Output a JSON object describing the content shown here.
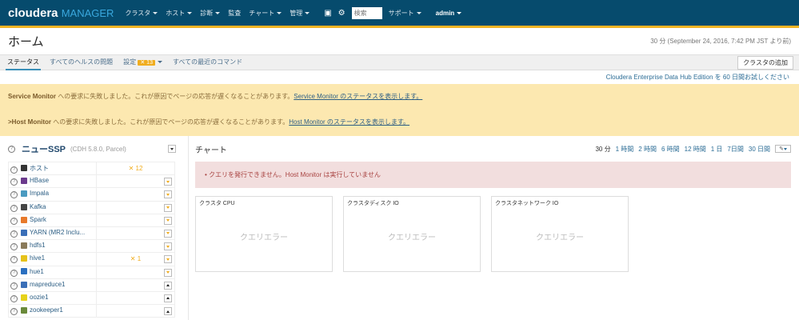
{
  "nav": {
    "logo_a": "cloudera",
    "logo_b": "MANAGER",
    "items": [
      "クラスタ",
      "ホスト",
      "診断",
      "監査",
      "チャート",
      "管理"
    ],
    "search_placeholder": "検索",
    "support": "サポート",
    "user": "admin"
  },
  "header": {
    "title": "ホーム",
    "timestamp": "30 分 (September 24, 2016, 7:42 PM JST より前)"
  },
  "tabs": {
    "status": "ステータス",
    "health": "すべてのヘルスの問題",
    "config": "設定",
    "config_badge": "13",
    "commands": "すべての最近のコマンド",
    "add_cluster": "クラスタの追加"
  },
  "trial": "Cloudera Enterprise Data Hub Edition を 60 日間お試しください",
  "alerts": [
    {
      "name": "Service Monitor",
      "msg": " への要求に失敗しました。これが原因でページの応答が遅くなることがあります。",
      "link": "Service Monitor のステータスを表示します。"
    },
    {
      "name": ">Host Monitor",
      "msg": " への要求に失敗しました。これが原因でページの応答が遅くなることがあります。",
      "link": "Host Monitor のステータスを表示します。"
    }
  ],
  "cluster": {
    "name": "ニューSSP",
    "version": "(CDH 5.8.0, Parcel)",
    "services": [
      {
        "name": "ホスト",
        "badge": "12",
        "color": "#333"
      },
      {
        "name": "HBase",
        "color": "#6b3a8c"
      },
      {
        "name": "Impala",
        "color": "#4a9ac0"
      },
      {
        "name": "Kafka",
        "color": "#444"
      },
      {
        "name": "Spark",
        "color": "#e8792a"
      },
      {
        "name": "YARN (MR2 Inclu...",
        "color": "#3a6fb8"
      },
      {
        "name": "hdfs1",
        "color": "#8a7a5a"
      },
      {
        "name": "hive1",
        "badge": "1",
        "color": "#e6c21a"
      },
      {
        "name": "hue1",
        "color": "#2a6fc0"
      },
      {
        "name": "mapreduce1",
        "color": "#3a6fb8"
      },
      {
        "name": "oozie1",
        "color": "#e6d21a"
      },
      {
        "name": "zookeeper1",
        "color": "#6a8a3a"
      }
    ]
  },
  "charts": {
    "title": "チャート",
    "ranges": [
      "30 分",
      "1 時間",
      "2 時間",
      "6 時間",
      "12 時間",
      "1 日",
      "7日間",
      "30 日間"
    ],
    "error": "クエリを発行できません。Host Monitor は実行していません",
    "panels": [
      {
        "title": "クラスタ CPU",
        "msg": "クエリエラー"
      },
      {
        "title": "クラスタディスク IO",
        "msg": "クエリエラー"
      },
      {
        "title": "クラスタネットワーク IO",
        "msg": "クエリエラー"
      }
    ]
  }
}
